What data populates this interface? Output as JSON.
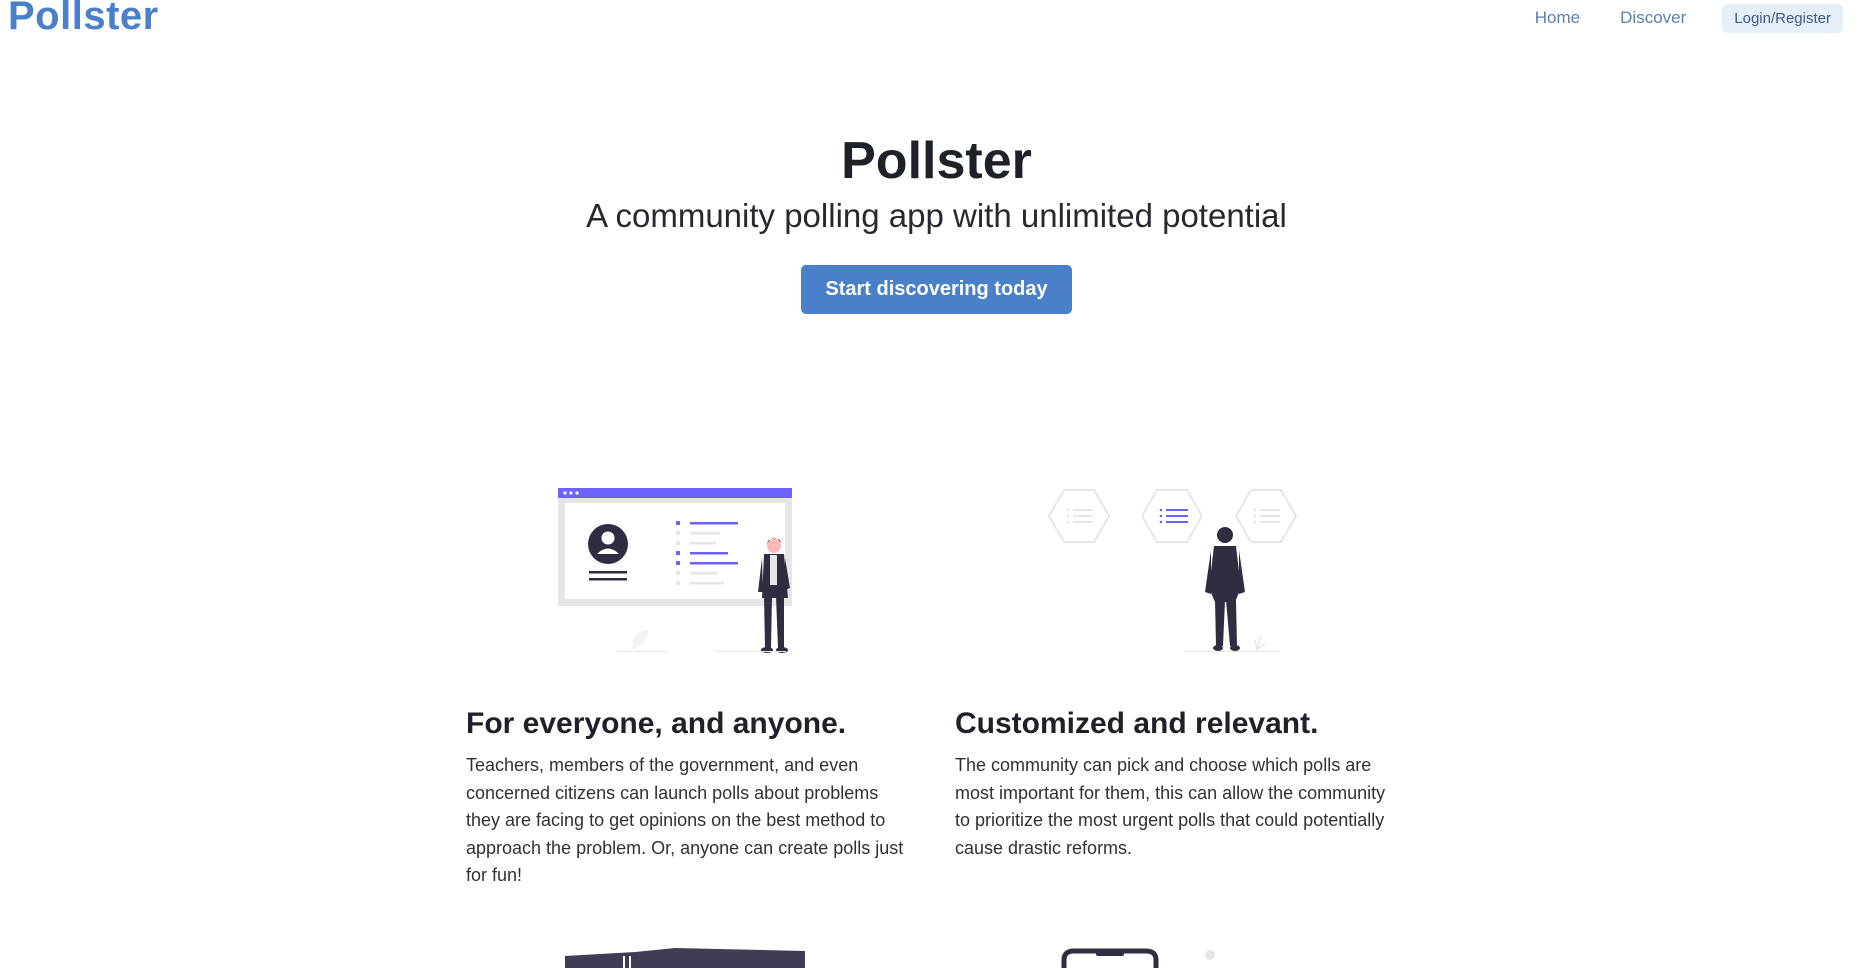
{
  "navbar": {
    "brand": "Pollster",
    "links": [
      {
        "label": "Home"
      },
      {
        "label": "Discover"
      }
    ],
    "login_label": "Login/Register"
  },
  "hero": {
    "title": "Pollster",
    "subtitle": "A community polling app with unlimited potential",
    "cta_label": "Start discovering today"
  },
  "features": [
    {
      "title": "For everyone, and anyone.",
      "text": "Teachers, members of the government, and even concerned citizens can launch polls about problems they are facing to get opinions on the best method to approach the problem. Or, anyone can create polls just for fun!",
      "illustration": "presentation-board-illustration"
    },
    {
      "title": "Customized and relevant.",
      "text": "The community can pick and choose which polls are most important for them, this can allow the community to prioritize the most urgent polls that could potentially cause drastic reforms.",
      "illustration": "hexagon-choices-illustration"
    }
  ],
  "colors": {
    "brand": "#4a7fc9",
    "accent_purple": "#6c63ff",
    "dark_figure": "#2f2e41",
    "light_gray": "#e6e6e6"
  }
}
